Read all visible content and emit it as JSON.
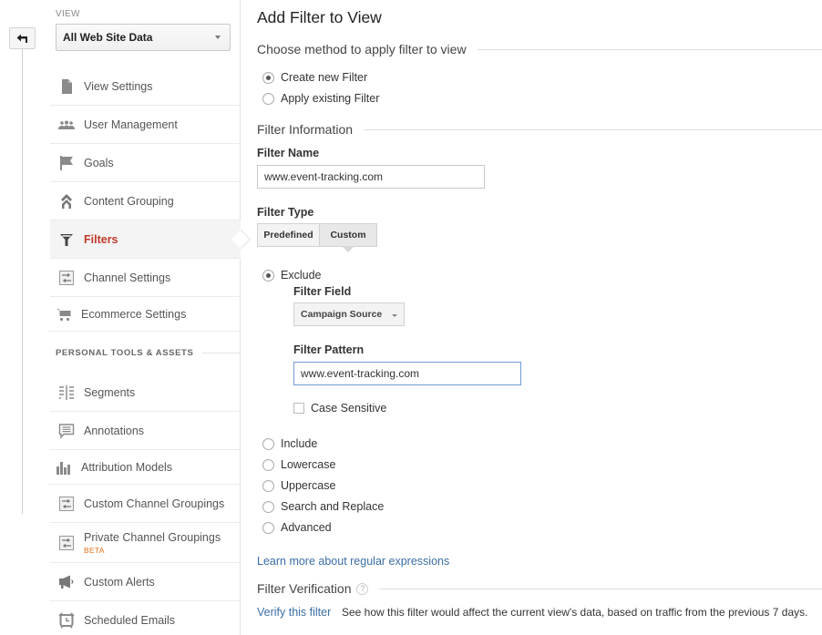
{
  "sidebar": {
    "view_label": "VIEW",
    "view_selected": "All Web Site Data",
    "items": [
      {
        "label": "View Settings",
        "icon": "document-icon"
      },
      {
        "label": "User Management",
        "icon": "users-icon"
      },
      {
        "label": "Goals",
        "icon": "flag-icon"
      },
      {
        "label": "Content Grouping",
        "icon": "content-grouping-icon"
      },
      {
        "label": "Filters",
        "icon": "filter-icon",
        "active": true
      },
      {
        "label": "Channel Settings",
        "icon": "channel-icon"
      },
      {
        "label": "Ecommerce Settings",
        "icon": "cart-icon"
      }
    ],
    "personal_section_label": "PERSONAL TOOLS & ASSETS",
    "personal_items": [
      {
        "label": "Segments",
        "icon": "segments-icon"
      },
      {
        "label": "Annotations",
        "icon": "annotation-icon"
      },
      {
        "label": "Attribution Models",
        "icon": "bar-chart-icon"
      },
      {
        "label": "Custom Channel Groupings",
        "icon": "channel-icon"
      },
      {
        "label": "Private Channel Groupings",
        "icon": "channel-icon",
        "badge": "BETA"
      },
      {
        "label": "Custom Alerts",
        "icon": "megaphone-icon"
      },
      {
        "label": "Scheduled Emails",
        "icon": "alarm-clock-icon"
      }
    ]
  },
  "main": {
    "title": "Add Filter to View",
    "method_section": "Choose method to apply filter to view",
    "method_options": [
      {
        "label": "Create new Filter",
        "checked": true
      },
      {
        "label": "Apply existing Filter",
        "checked": false
      }
    ],
    "info_section": "Filter Information",
    "filter_name_label": "Filter Name",
    "filter_name_value": "www.event-tracking.com",
    "filter_type_label": "Filter Type",
    "filter_type_tabs": [
      "Predefined",
      "Custom"
    ],
    "filter_type_selected": "Custom",
    "custom_options": [
      {
        "label": "Exclude",
        "checked": true
      },
      {
        "label": "Include",
        "checked": false
      },
      {
        "label": "Lowercase",
        "checked": false
      },
      {
        "label": "Uppercase",
        "checked": false
      },
      {
        "label": "Search and Replace",
        "checked": false
      },
      {
        "label": "Advanced",
        "checked": false
      }
    ],
    "filter_field_label": "Filter Field",
    "filter_field_value": "Campaign Source",
    "filter_pattern_label": "Filter Pattern",
    "filter_pattern_value": "www.event-tracking.com",
    "case_sensitive_label": "Case Sensitive",
    "case_sensitive_checked": false,
    "regex_link": "Learn more about regular expressions",
    "verification_section": "Filter Verification",
    "help_glyph": "?",
    "verify_link": "Verify this filter",
    "verify_description": "See how this filter would affect the current view's data, based on traffic from the previous 7 days."
  }
}
